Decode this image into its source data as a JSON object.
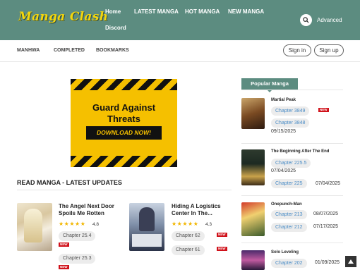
{
  "header": {
    "logo": "Manga Clash",
    "nav": [
      "Home",
      "LATEST MANGA",
      "HOT MANGA",
      "NEW MANGA",
      "Discord"
    ],
    "advanced": "Advanced"
  },
  "subnav": {
    "items": [
      "MANHWA",
      "COMPLETED",
      "BOOKMARKS"
    ],
    "sign_in": "Sign in",
    "sign_up": "Sign up"
  },
  "ad": {
    "title_line1": "Guard Against",
    "title_line2": "Threats",
    "button": "DOWNLOAD NOW!"
  },
  "latest": {
    "heading": "READ MANGA - LATEST UPDATES",
    "items": [
      {
        "title_line1": "The Angel Next Door",
        "title_line2": "Spoils Me Rotten",
        "stars": "★★★★★",
        "rating": "4.8",
        "chapters": [
          "Chapter 25.4",
          "Chapter 25.3"
        ],
        "new_badge": "NEW"
      },
      {
        "title_line1": "Hiding A Logistics",
        "title_line2": "Center In The...",
        "stars": "★★★★★",
        "rating": "4.3",
        "chapters": [
          "Chapter 62",
          "Chapter 61"
        ],
        "new_badge": "NEW"
      }
    ]
  },
  "popular": {
    "heading": "Popular Manga",
    "items": [
      {
        "title": "Martial Peak",
        "chapters": [
          {
            "label": "Chapter 3849",
            "badge": "NEW"
          },
          {
            "label": "Chapter 3848",
            "date": "09/15/2025"
          }
        ]
      },
      {
        "title": "The Beginning After The End",
        "chapters": [
          {
            "label": "Chapter 225.5",
            "date": "07/04/2025"
          },
          {
            "label": "Chapter 225",
            "date": "07/04/2025"
          }
        ]
      },
      {
        "title": "Onepunch-Man",
        "chapters": [
          {
            "label": "Chapter 213",
            "date": "08/07/2025"
          },
          {
            "label": "Chapter 212",
            "date": "07/17/2025"
          }
        ]
      },
      {
        "title": "Solo Leveling",
        "chapters": [
          {
            "label": "Chapter 202",
            "date": "01/09/2025"
          }
        ]
      }
    ]
  },
  "colors": {
    "header": "#5c8c80",
    "logo": "#f4d60c",
    "new_badge": "#d0121b",
    "chapter_link": "#4a8cc6",
    "star": "#f2b600"
  }
}
